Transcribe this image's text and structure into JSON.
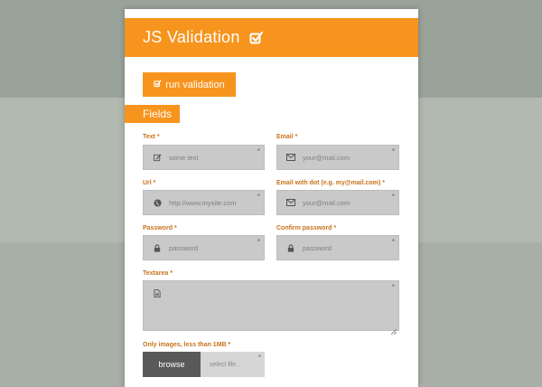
{
  "header": {
    "title": "JS Validation",
    "icon": "check-square-icon"
  },
  "run_button": {
    "label": "run validation",
    "icon": "check-square-icon"
  },
  "section": {
    "label": "Fields"
  },
  "fields": {
    "text": {
      "label": "Text *",
      "placeholder": "some text",
      "icon": "pencil-square-icon",
      "required_mark": "*"
    },
    "email": {
      "label": "Email *",
      "placeholder": "your@mail.com",
      "icon": "envelope-icon",
      "required_mark": "*"
    },
    "url": {
      "label": "Url *",
      "placeholder": "http://www.mysite.com",
      "icon": "globe-icon",
      "required_mark": "*"
    },
    "email_dot": {
      "label": "Email with dot (e.g. my@mail.com) *",
      "placeholder": "your@mail.com",
      "icon": "envelope-icon",
      "required_mark": "*"
    },
    "password": {
      "label": "Password *",
      "placeholder": "password",
      "icon": "lock-icon",
      "required_mark": "*"
    },
    "confirm_password": {
      "label": "Confirm password *",
      "placeholder": "password",
      "icon": "lock-icon",
      "required_mark": "*"
    },
    "textarea": {
      "label": "Textarea *",
      "icon": "document-icon",
      "required_mark": "*"
    },
    "file": {
      "label": "Only images, less than 1MB *",
      "button_label": "browse",
      "placeholder": "select file...",
      "required_mark": "*"
    }
  },
  "colors": {
    "accent": "#f7941d",
    "label": "#c8731a",
    "field_bg": "#c9c9c9",
    "browse_bg": "#595959"
  }
}
